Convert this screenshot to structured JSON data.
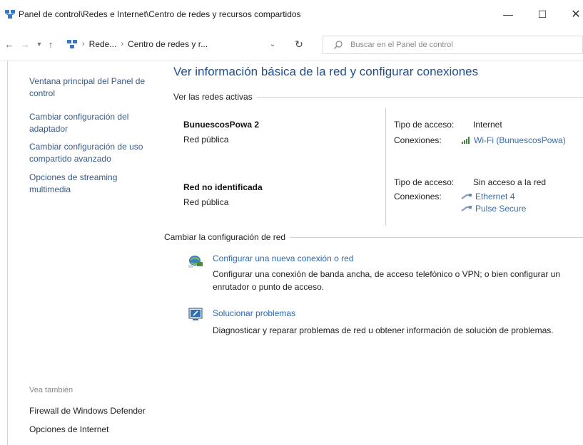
{
  "window": {
    "title": "Panel de control\\Redes e Internet\\Centro de redes y recursos compartidos",
    "minimize": "—",
    "maximize": "☐",
    "close": "✕"
  },
  "addressbar": {
    "crumb1": "Rede...",
    "crumb2": "Centro de redes y r...",
    "search_placeholder": "Buscar en el Panel de control"
  },
  "sidebar": {
    "items": [
      {
        "label": "Ventana principal del Panel de control"
      },
      {
        "label": "Cambiar configuración del adaptador"
      },
      {
        "label": "Cambiar configuración de uso compartido avanzado"
      },
      {
        "label": "Opciones de streaming multimedia"
      }
    ],
    "see_also_title": "Vea también",
    "see_also": [
      {
        "label": "Firewall de Windows Defender"
      },
      {
        "label": "Opciones de Internet"
      }
    ]
  },
  "main": {
    "title": "Ver información básica de la red y configurar conexiones",
    "active_networks_label": "Ver las redes activas",
    "networks": [
      {
        "name": "BunuescosPowa 2",
        "category": "Red pública",
        "access_label": "Tipo de acceso:",
        "access_value": "Internet",
        "connections_label": "Conexiones:",
        "connections": [
          "Wi-Fi (BunuescosPowa)"
        ]
      },
      {
        "name": "Red no identificada",
        "category": "Red pública",
        "access_label": "Tipo de acceso:",
        "access_value": "Sin acceso a la red",
        "connections_label": "Conexiones:",
        "connections": [
          "Ethernet 4",
          "Pulse Secure"
        ]
      }
    ],
    "change_settings_label": "Cambiar la configuración de red",
    "tasks": [
      {
        "link": "Configurar una nueva conexión o red",
        "description": "Configurar una conexión de banda ancha, de acceso telefónico o VPN; o bien configurar un enrutador o punto de acceso."
      },
      {
        "link": "Solucionar problemas",
        "description": "Diagnosticar y reparar problemas de red u obtener información de solución de problemas."
      }
    ]
  },
  "colors": {
    "link": "#3a6ea8",
    "title": "#1e4f8f",
    "sidebar_link": "#3a5a86"
  }
}
